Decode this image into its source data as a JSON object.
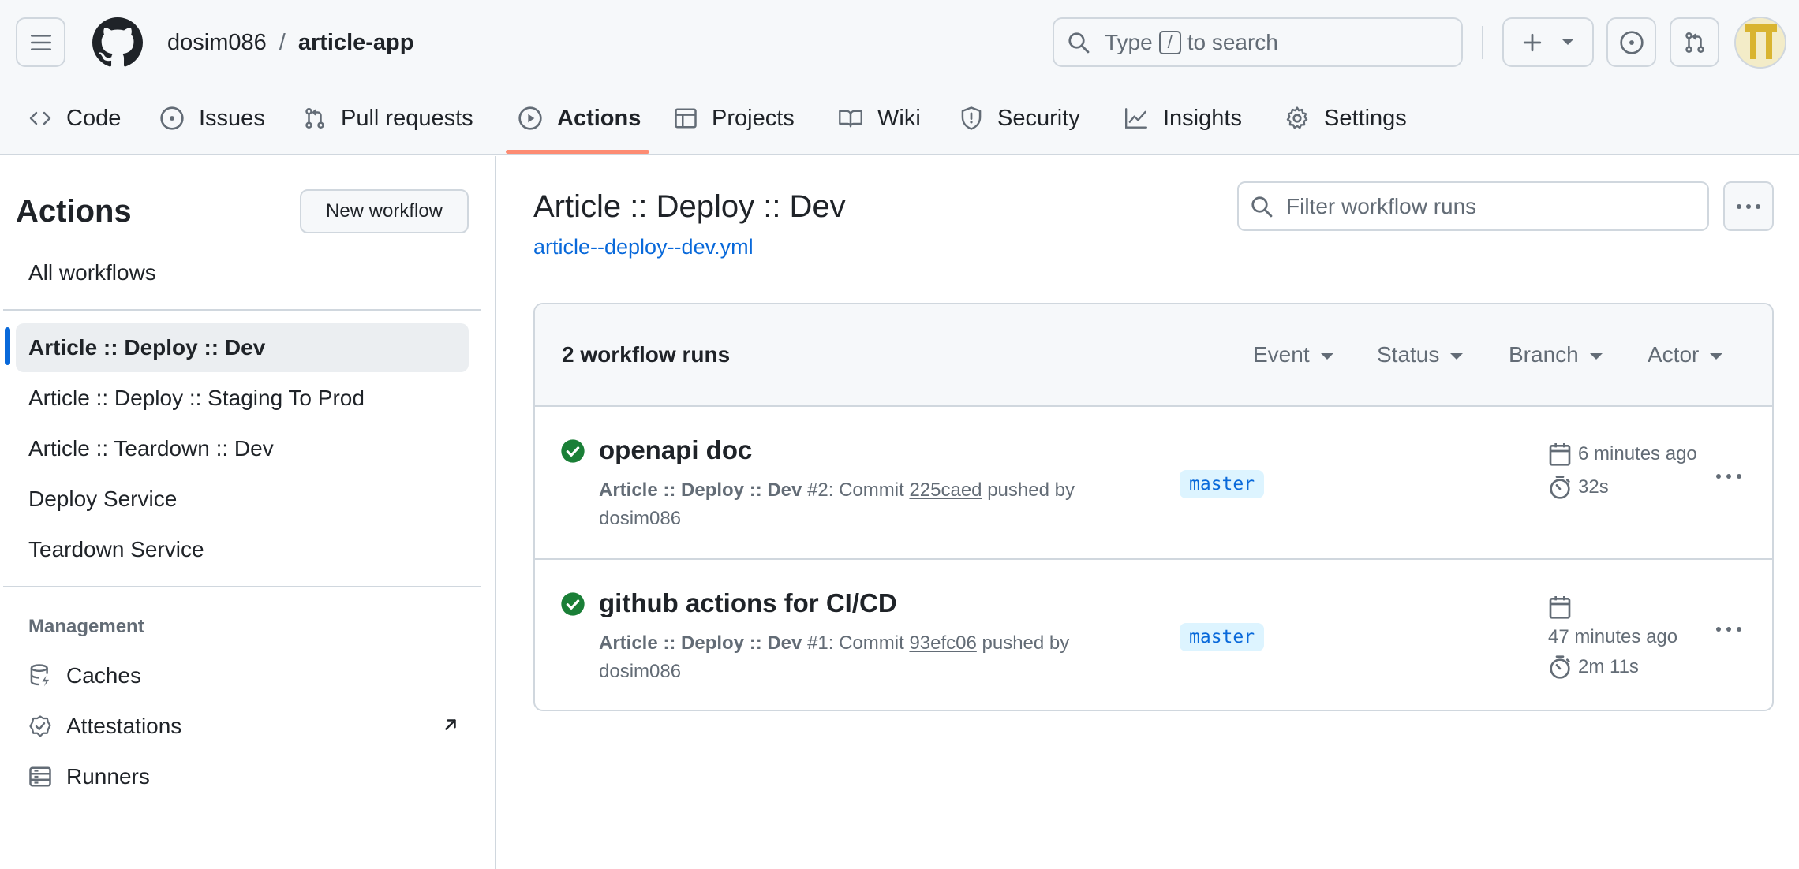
{
  "topbar": {
    "owner": "dosim086",
    "separator": "/",
    "repo": "article-app",
    "search_prefix": "Type",
    "search_key": "/",
    "search_suffix": "to search"
  },
  "repo_nav": {
    "items": [
      {
        "label": "Code",
        "icon": "code-icon"
      },
      {
        "label": "Issues",
        "icon": "issue-opened-icon"
      },
      {
        "label": "Pull requests",
        "icon": "git-pull-request-icon"
      },
      {
        "label": "Actions",
        "icon": "play-icon",
        "active": true
      },
      {
        "label": "Projects",
        "icon": "table-icon"
      },
      {
        "label": "Wiki",
        "icon": "book-icon"
      },
      {
        "label": "Security",
        "icon": "shield-icon"
      },
      {
        "label": "Insights",
        "icon": "graph-icon"
      },
      {
        "label": "Settings",
        "icon": "gear-icon"
      }
    ]
  },
  "sidebar": {
    "title": "Actions",
    "new_workflow": "New workflow",
    "all_workflows": "All workflows",
    "workflows": [
      "Article :: Deploy :: Dev",
      "Article :: Deploy :: Staging To Prod",
      "Article :: Teardown :: Dev",
      "Deploy Service",
      "Teardown Service"
    ],
    "selected_index": 0,
    "management_heading": "Management",
    "management": [
      {
        "label": "Caches",
        "icon": "database-icon"
      },
      {
        "label": "Attestations",
        "icon": "verified-icon"
      },
      {
        "label": "Runners",
        "icon": "server-icon"
      }
    ]
  },
  "main": {
    "title": "Article :: Deploy :: Dev",
    "file": "article--deploy--dev.yml",
    "filter_placeholder": "Filter workflow runs",
    "runs_count": "2 workflow runs",
    "filters": [
      "Event",
      "Status",
      "Branch",
      "Actor"
    ],
    "runs": [
      {
        "title": "openapi doc",
        "workflow": "Article :: Deploy :: Dev",
        "number": "#2",
        "commit_label": ": Commit",
        "commit": "225caed",
        "pushed_by": "pushed by",
        "actor": "dosim086",
        "branch": "master",
        "time": "6 minutes ago",
        "duration": "32s",
        "status": "success"
      },
      {
        "title": "github actions for CI/CD",
        "workflow": "Article :: Deploy :: Dev",
        "number": "#1",
        "commit_label": ": Commit",
        "commit": "93efc06",
        "pushed_by": "pushed by",
        "actor": "dosim086",
        "branch": "master",
        "time": "47 minutes ago",
        "duration": "2m 11s",
        "status": "success"
      }
    ]
  },
  "colors": {
    "accent": "#0969da",
    "success": "#1a7f37",
    "underline": "#fd8c73",
    "border": "#d0d7de",
    "muted": "#636c76"
  }
}
